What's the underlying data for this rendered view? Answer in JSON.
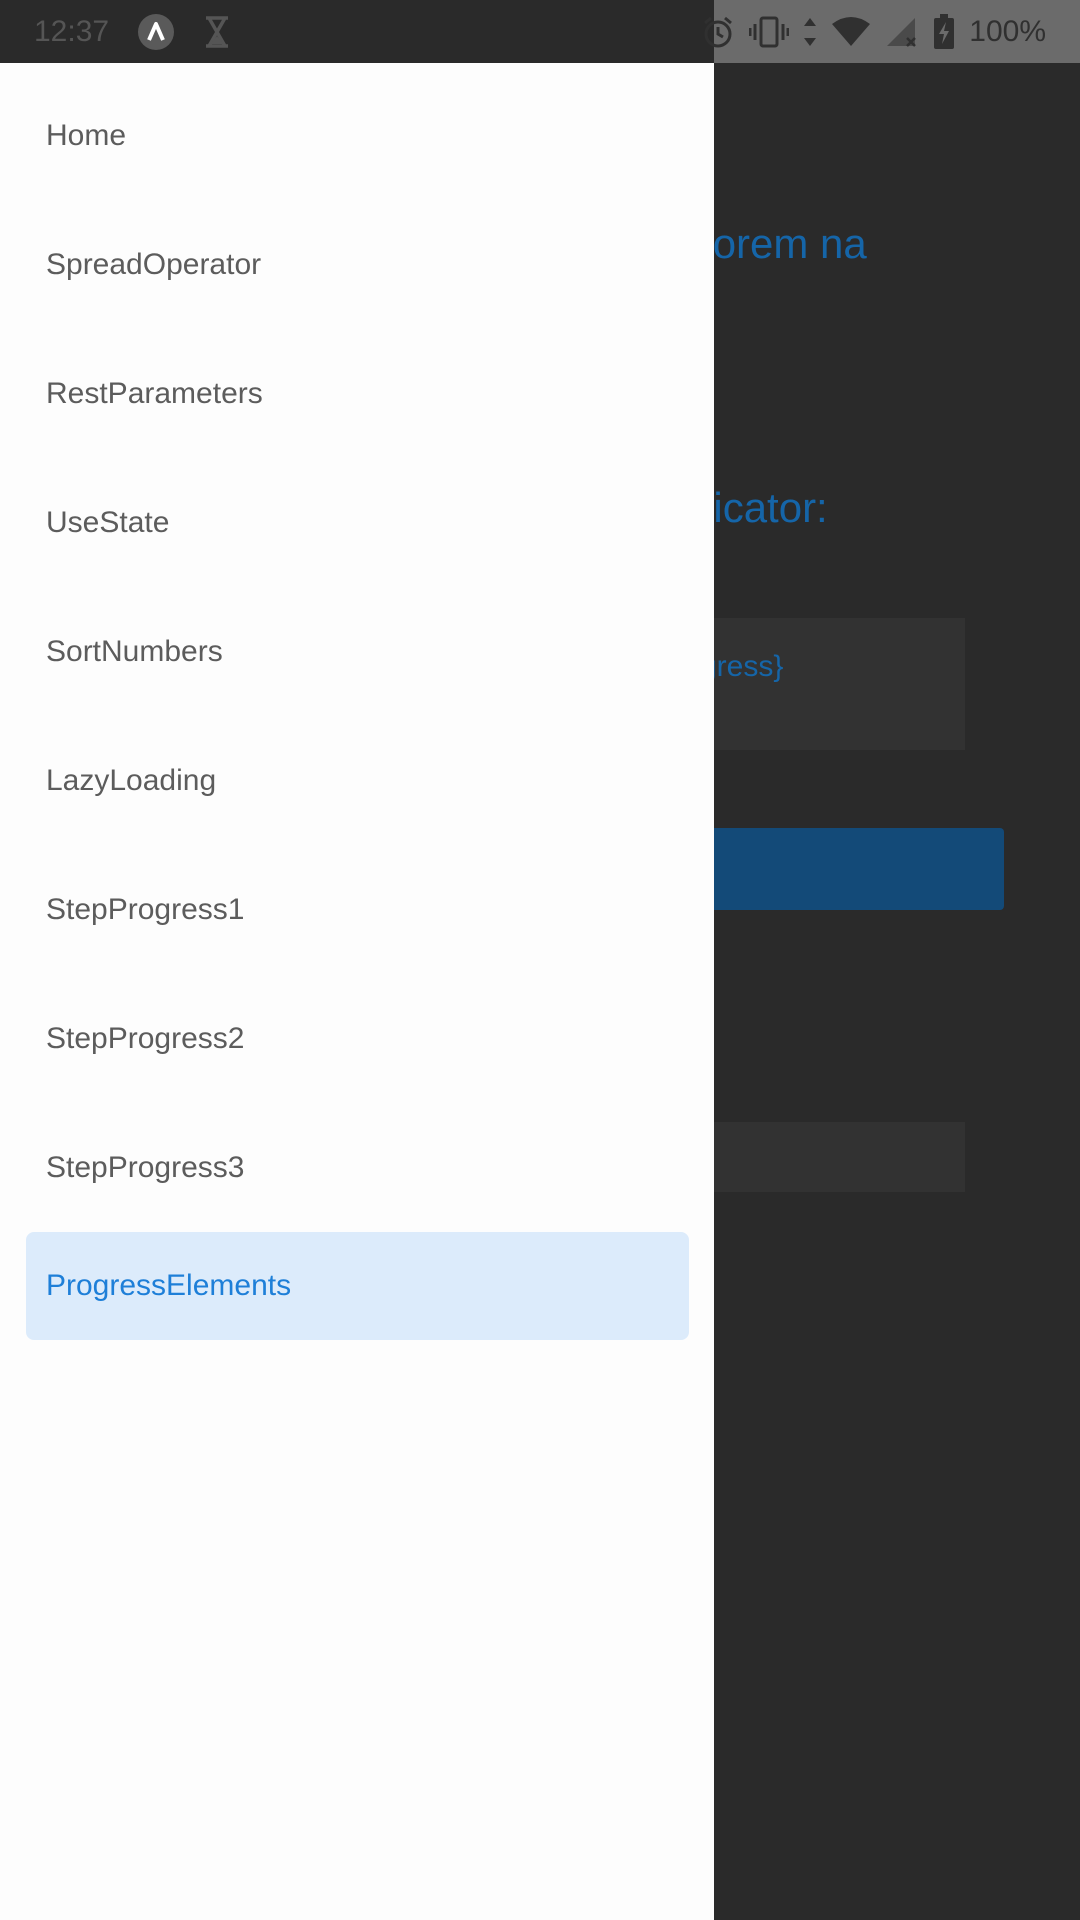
{
  "status_bar": {
    "time": "12:37",
    "battery_percent": "100%",
    "icons_left": [
      "app-notification-icon",
      "hourglass-icon"
    ],
    "icons_right": [
      "alarm-icon",
      "vibrate-icon",
      "data-arrows-icon",
      "wifi-icon",
      "signal-icon",
      "battery-charging-icon"
    ]
  },
  "drawer": {
    "items": [
      {
        "label": "Home"
      },
      {
        "label": "SpreadOperator"
      },
      {
        "label": "RestParameters"
      },
      {
        "label": "UseState"
      },
      {
        "label": "SortNumbers"
      },
      {
        "label": "LazyLoading"
      },
      {
        "label": "StepProgress1"
      },
      {
        "label": "StepProgress2"
      },
      {
        "label": "StepProgress3"
      },
      {
        "label": "ProgressElements",
        "active": true
      }
    ],
    "active_color": "#1e7fd8",
    "active_background": "#dcebfb"
  },
  "background_app": {
    "heading_1_visible": "olorem na",
    "heading_2_visible": "dicator:",
    "box_text_visible": "gress}",
    "accent_color": "#1565a8",
    "button_color": "#134a78"
  }
}
